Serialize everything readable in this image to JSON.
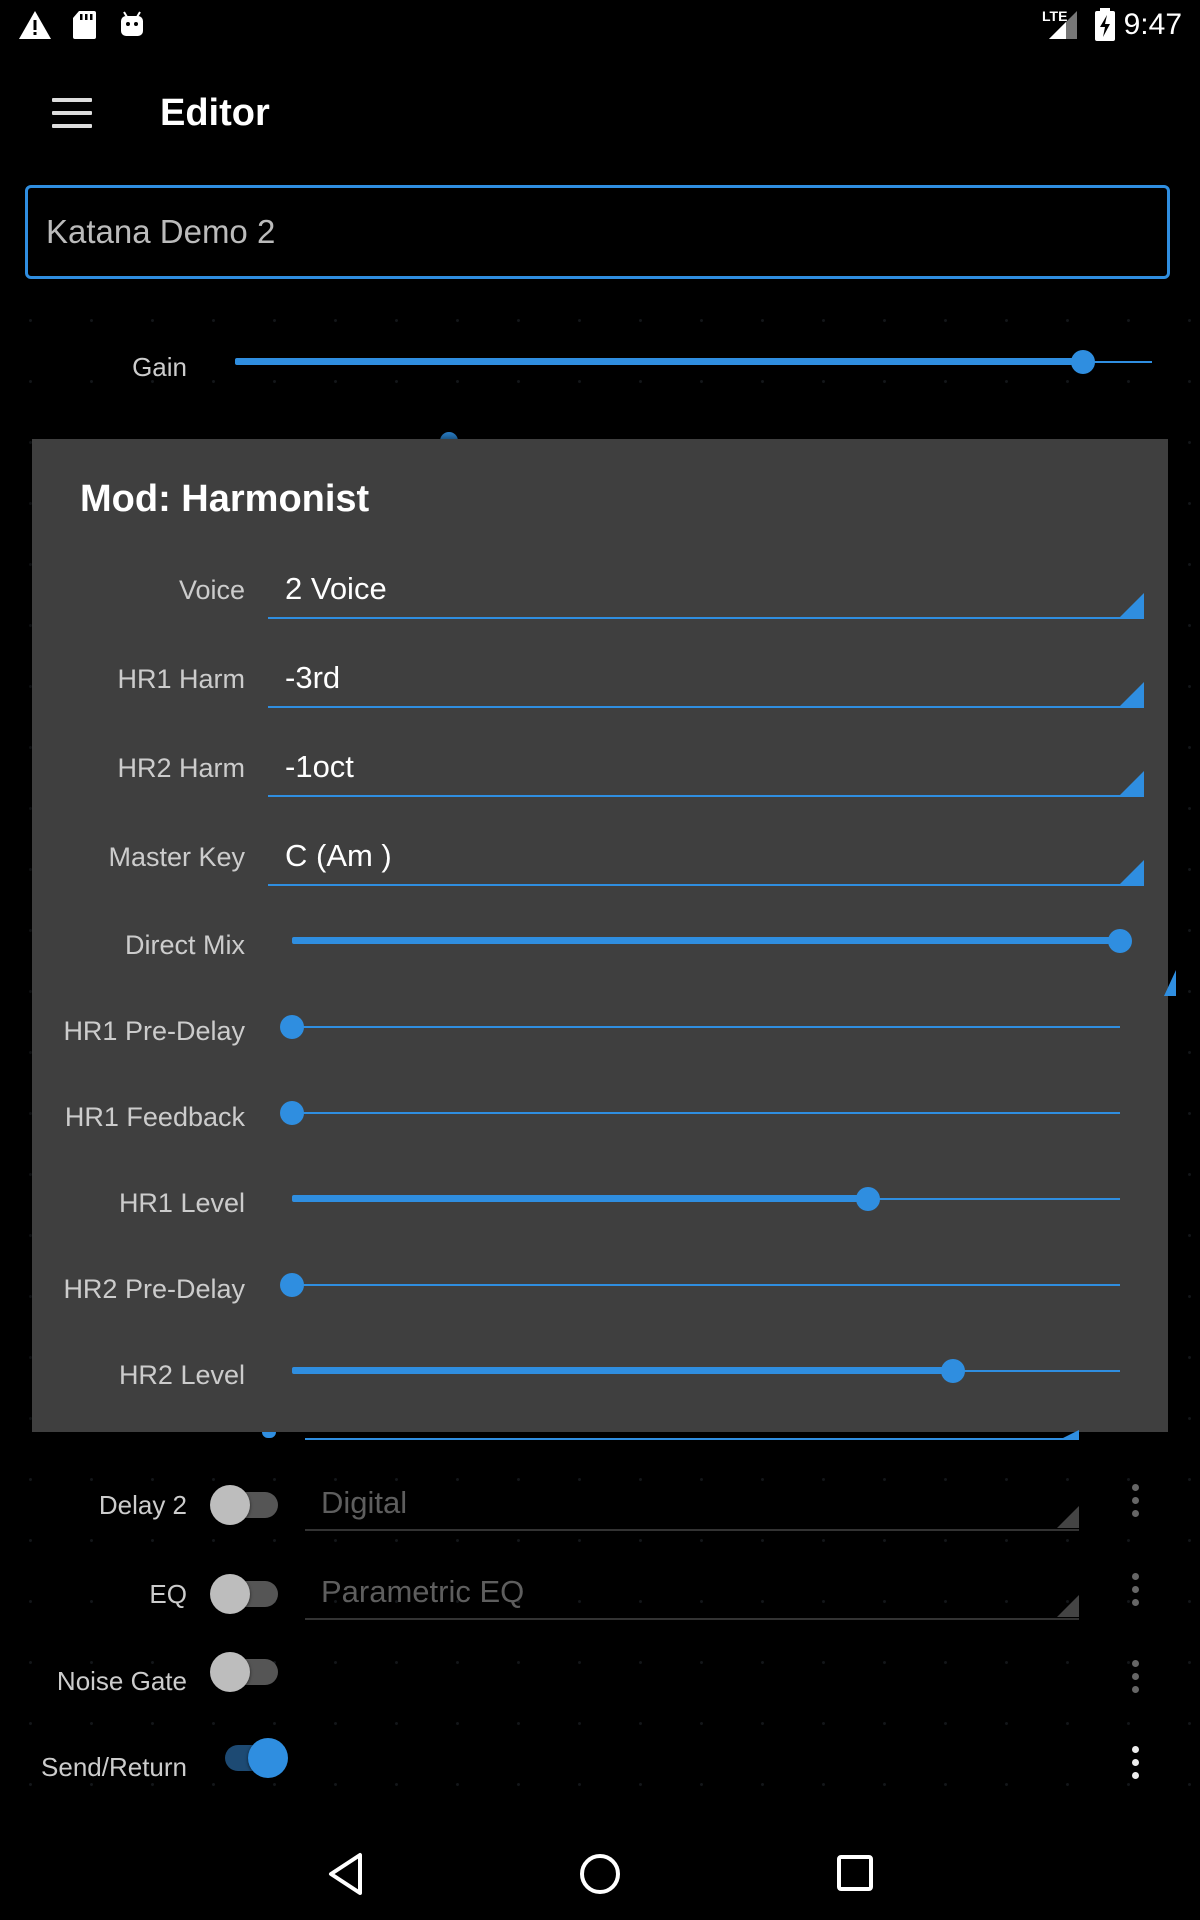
{
  "status_bar": {
    "time": "9:47",
    "network": "LTE",
    "icons": [
      "warning-icon",
      "sd-card-icon",
      "android-icon",
      "signal-icon",
      "battery-charging-icon"
    ]
  },
  "app_bar": {
    "title": "Editor",
    "menu_icon": "hamburger-menu-icon"
  },
  "patch_name": "Katana Demo 2",
  "gain": {
    "label": "Gain",
    "value": 0.925
  },
  "dialog": {
    "title": "Mod: Harmonist",
    "selects": [
      {
        "label": "Voice",
        "value": "2 Voice"
      },
      {
        "label": "HR1 Harm",
        "value": "-3rd"
      },
      {
        "label": "HR2 Harm",
        "value": "-1oct"
      },
      {
        "label": "Master Key",
        "value": "C (Am )"
      }
    ],
    "sliders": [
      {
        "label": "Direct Mix",
        "value": 1.0
      },
      {
        "label": "HR1 Pre-Delay",
        "value": 0.0
      },
      {
        "label": "HR1 Feedback",
        "value": 0.0
      },
      {
        "label": "HR1 Level",
        "value": 0.696
      },
      {
        "label": "HR2 Pre-Delay",
        "value": 0.0
      },
      {
        "label": "HR2 Level",
        "value": 0.798
      }
    ]
  },
  "effects": [
    {
      "label": "Delay 2",
      "type": "Digital",
      "enabled": false
    },
    {
      "label": "EQ",
      "type": "Parametric EQ",
      "enabled": false
    },
    {
      "label": "Noise Gate",
      "type": "",
      "enabled": false
    },
    {
      "label": "Send/Return",
      "type": "",
      "enabled": true
    }
  ],
  "colors": {
    "accent": "#2f8ee0",
    "dialog_bg": "#3f3f3f",
    "background": "#000000"
  },
  "nav_bar": {
    "icons": [
      "back-icon",
      "home-icon",
      "recents-icon"
    ]
  }
}
